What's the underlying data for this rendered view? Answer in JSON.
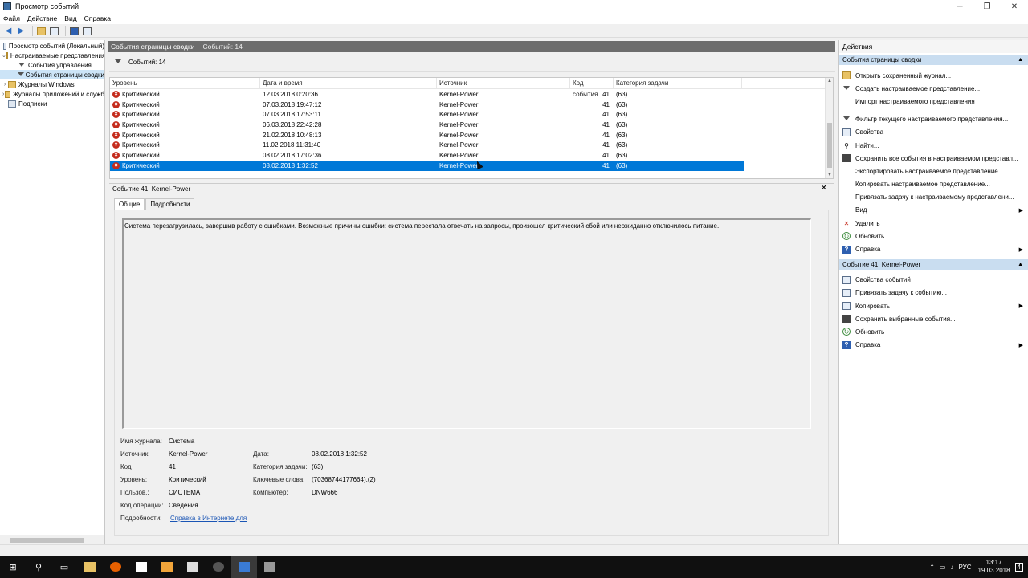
{
  "window": {
    "title": "Просмотр событий",
    "controls": {
      "min": "─",
      "max": "❐",
      "close": "✕"
    }
  },
  "menu": [
    "Файл",
    "Действие",
    "Вид",
    "Справка"
  ],
  "tree": {
    "items": [
      {
        "label": "Просмотр событий (Локальный)",
        "exp": "",
        "indent": 0,
        "icon": "log"
      },
      {
        "label": "Настраиваемые представления",
        "exp": "⌄",
        "indent": 0,
        "icon": "folder"
      },
      {
        "label": "События управления",
        "exp": "",
        "indent": 1,
        "icon": "filter"
      },
      {
        "label": "События страницы сводки",
        "exp": "",
        "indent": 1,
        "icon": "filter",
        "selected": true
      },
      {
        "label": "Журналы Windows",
        "exp": "›",
        "indent": 0,
        "icon": "folder"
      },
      {
        "label": "Журналы приложений и служб",
        "exp": "›",
        "indent": 0,
        "icon": "folder"
      },
      {
        "label": "Подписки",
        "exp": "",
        "indent": 0,
        "icon": "log"
      }
    ]
  },
  "center": {
    "header_title": "События страницы сводки",
    "header_count": "Событий: 14",
    "filter_count": "Событий: 14",
    "columns": [
      "Уровень",
      "Дата и время",
      "Источник",
      "Код события",
      "Категория задачи"
    ],
    "rows": [
      {
        "level": "Критический",
        "datetime": "12.03.2018 0:20:36",
        "source": "Kernel-Power",
        "code": "41",
        "category": "(63)"
      },
      {
        "level": "Критический",
        "datetime": "07.03.2018 19:47:12",
        "source": "Kernel-Power",
        "code": "41",
        "category": "(63)"
      },
      {
        "level": "Критический",
        "datetime": "07.03.2018 17:53:11",
        "source": "Kernel-Power",
        "code": "41",
        "category": "(63)"
      },
      {
        "level": "Критический",
        "datetime": "06.03.2018 22:42:28",
        "source": "Kernel-Power",
        "code": "41",
        "category": "(63)"
      },
      {
        "level": "Критический",
        "datetime": "21.02.2018 10:48:13",
        "source": "Kernel-Power",
        "code": "41",
        "category": "(63)"
      },
      {
        "level": "Критический",
        "datetime": "11.02.2018 11:31:40",
        "source": "Kernel-Power",
        "code": "41",
        "category": "(63)"
      },
      {
        "level": "Критический",
        "datetime": "08.02.2018 17:02:36",
        "source": "Kernel-Power",
        "code": "41",
        "category": "(63)"
      },
      {
        "level": "Критический",
        "datetime": "08.02.2018 1:32:52",
        "source": "Kernel-Power",
        "code": "41",
        "category": "(63)",
        "selected": true
      }
    ]
  },
  "detail": {
    "title": "Событие 41, Kernel-Power",
    "tabs": [
      "Общие",
      "Подробности"
    ],
    "description": "Система перезагрузилась, завершив работу с ошибками. Возможные причины ошибки: система перестала отвечать на запросы, произошел критический сбой или неожиданно отключилось питание.",
    "props": {
      "log_name_label": "Имя журнала:",
      "log_name": "Система",
      "source_label": "Источник:",
      "source": "Kernel-Power",
      "date_label": "Дата:",
      "date": "08.02.2018 1:32:52",
      "code_label": "Код",
      "code": "41",
      "category_label": "Категория задачи:",
      "category": "(63)",
      "level_label": "Уровень:",
      "level": "Критический",
      "keywords_label": "Ключевые слова:",
      "keywords": "(70368744177664),(2)",
      "user_label": "Пользов.:",
      "user": "СИСТЕМА",
      "computer_label": "Компьютер:",
      "computer": "DNW666",
      "opcode_label": "Код операции:",
      "opcode": "Сведения",
      "more_label": "Подробности:",
      "more_link": "Справка в Интернете для"
    }
  },
  "actions": {
    "title": "Действия",
    "section1": "События страницы сводки",
    "items1": [
      {
        "label": "Открыть сохраненный журнал...",
        "icon": "open"
      },
      {
        "label": "Создать настраиваемое представление...",
        "icon": "filter"
      },
      {
        "label": "Импорт настраиваемого представления",
        "icon": ""
      },
      {
        "gap": true
      },
      {
        "label": "Фильтр текущего настраиваемого представления...",
        "icon": "filter"
      },
      {
        "label": "Свойства",
        "icon": "box"
      },
      {
        "label": "Найти...",
        "icon": "find"
      },
      {
        "label": "Сохранить все события в настраиваемом представл...",
        "icon": "save"
      },
      {
        "label": "Экспортировать настраиваемое представление...",
        "icon": ""
      },
      {
        "label": "Копировать настраиваемое представление...",
        "icon": ""
      },
      {
        "label": "Привязать задачу к настраиваемому представлени...",
        "icon": ""
      },
      {
        "label": "Вид",
        "icon": "",
        "sub": true
      },
      {
        "label": "Удалить",
        "icon": "del"
      },
      {
        "label": "Обновить",
        "icon": "refresh"
      },
      {
        "label": "Справка",
        "icon": "help",
        "sub": true
      }
    ],
    "section2": "Событие 41, Kernel-Power",
    "items2": [
      {
        "label": "Свойства событий",
        "icon": "box"
      },
      {
        "label": "Привязать задачу к событию...",
        "icon": "box"
      },
      {
        "label": "Копировать",
        "icon": "box",
        "sub": true
      },
      {
        "label": "Сохранить выбранные события...",
        "icon": "save"
      },
      {
        "label": "Обновить",
        "icon": "refresh"
      },
      {
        "label": "Справка",
        "icon": "help",
        "sub": true
      }
    ]
  },
  "taskbar": {
    "tray": {
      "lang": "РУС",
      "time": "13:17",
      "date": "19.03.2018",
      "notif": "4"
    }
  }
}
